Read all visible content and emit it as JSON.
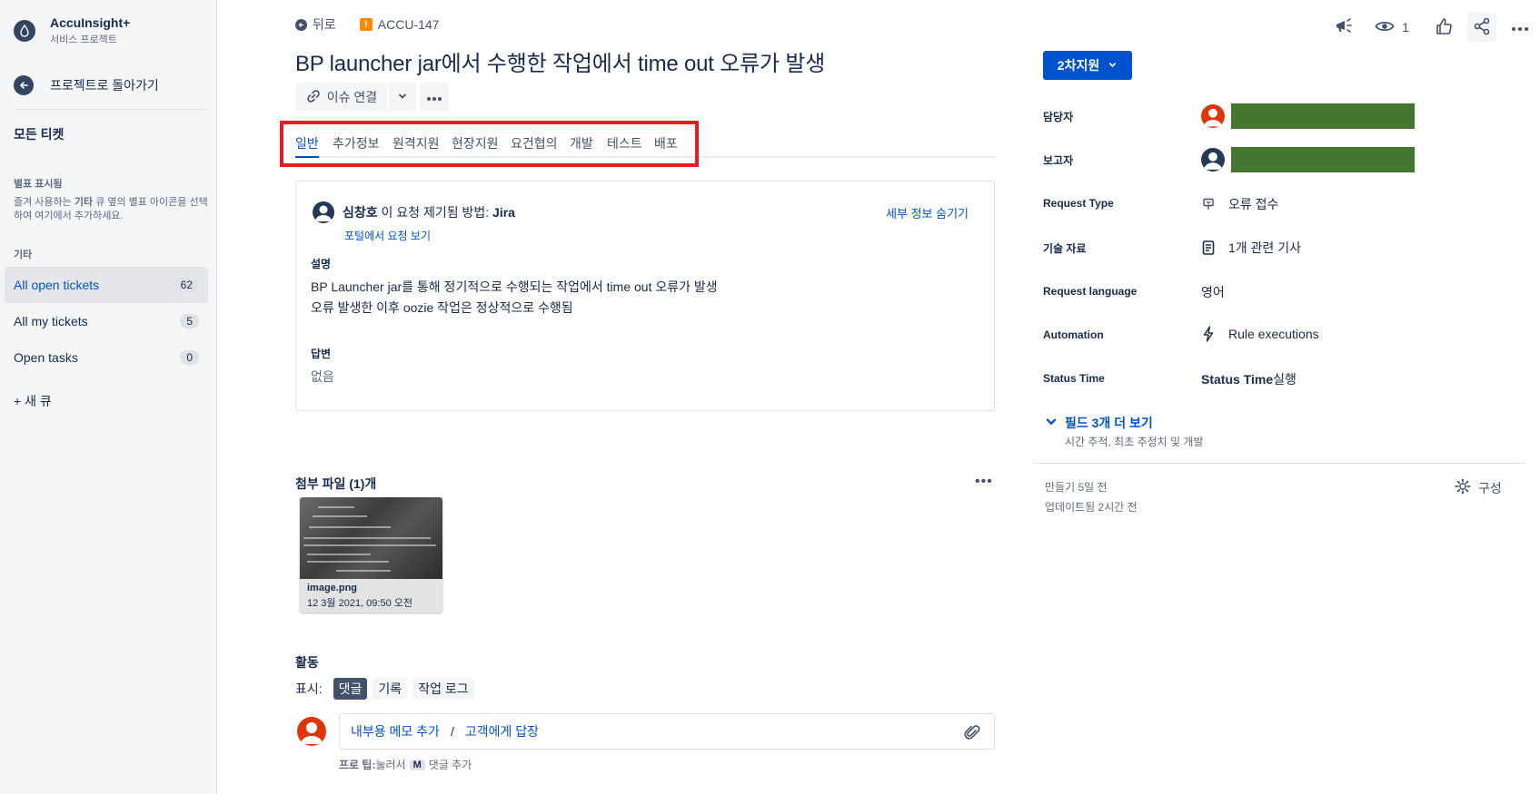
{
  "sidebar": {
    "project_name": "AccuInsight+",
    "project_type": "서비스 프로젝트",
    "back_label": "프로젝트로 돌아가기",
    "all_tickets": "모든 티켓",
    "starred_title": "별표 표시됨",
    "starred_desc_before": "즐겨 사용하는 ",
    "starred_desc_bold": "기타",
    "starred_desc_after": " 큐 옆의 별표 아이콘을 선택하여 여기에서 추가하세요.",
    "other_title": "기타",
    "queues": [
      {
        "label": "All open tickets",
        "count": "62",
        "active": true
      },
      {
        "label": "All my tickets",
        "count": "5",
        "active": false
      },
      {
        "label": "Open tasks",
        "count": "0",
        "active": false
      }
    ],
    "new_queue": "+ 새 큐"
  },
  "breadcrumb": {
    "back_label": "뒤로",
    "issue_key": "ACCU-147"
  },
  "issue": {
    "title": "BP launcher jar에서 수행한 작업에서 time out 오류가 발생",
    "link_issue_label": "이슈 연결"
  },
  "tabs": [
    "일반",
    "추가정보",
    "원격지원",
    "현장지원",
    "요건협의",
    "개발",
    "테스트",
    "배포"
  ],
  "details": {
    "reporter_name": "심창호",
    "raised_text": " 이 요청 제기됨 방법: ",
    "raised_via": "Jira",
    "portal_link": "포털에서 요청 보기",
    "hide_details": "세부 정보 숨기기",
    "description_label": "설명",
    "description_lines": [
      "BP Launcher jar를 통해 정기적으로 수행되는 작업에서 time out 오류가 발생",
      "오류 발생한 이후 oozie 작업은 정상적으로 수행됨"
    ],
    "answer_label": "답변",
    "answer_value": "없음"
  },
  "attachments": {
    "title": "첨부 파일 (1)개",
    "files": [
      {
        "name": "image.png",
        "date": "12 3월 2021, 09:50 오전"
      }
    ]
  },
  "activity": {
    "title": "활동",
    "show_label": "표시:",
    "filters": [
      {
        "label": "댓글",
        "active": true
      },
      {
        "label": "기록",
        "active": false
      },
      {
        "label": "작업 로그",
        "active": false
      }
    ],
    "internal_note": "내부용 메모 추가",
    "separator": "/",
    "reply_customer": "고객에게 답장",
    "protip_before": "프로 팁:",
    "protip_mid": " 눌러서 ",
    "protip_key": "M",
    "protip_after": " 댓글 추가"
  },
  "top_actions": {
    "watch_count": "1"
  },
  "right_panel": {
    "status": "2차지원",
    "fields": {
      "assignee_label": "담당자",
      "reporter_label": "보고자",
      "request_type_label": "Request Type",
      "request_type_value": "오류 접수",
      "knowledge_label": "기술 자료",
      "knowledge_value": "1개 관련 기사",
      "language_label": "Request language",
      "language_value": "영어",
      "automation_label": "Automation",
      "automation_value": "Rule executions",
      "status_time_label": "Status Time",
      "status_time_bold": "Status Time",
      "status_time_suffix": " 실행"
    },
    "more_fields": "필드 3개 더 보기",
    "more_fields_sub": "시간 추적, 최초 추정치 및 개발",
    "created": "만들기 5일 전",
    "updated": "업데이트됨 2시간 전",
    "configure": "구성"
  },
  "colors": {
    "primary": "#0052cc",
    "status_button": "#0052cc",
    "redacted_block": "#43762f",
    "highlight": "#e81d1d",
    "issue_type": "#ff8b00",
    "avatar_red": "#de350b"
  }
}
